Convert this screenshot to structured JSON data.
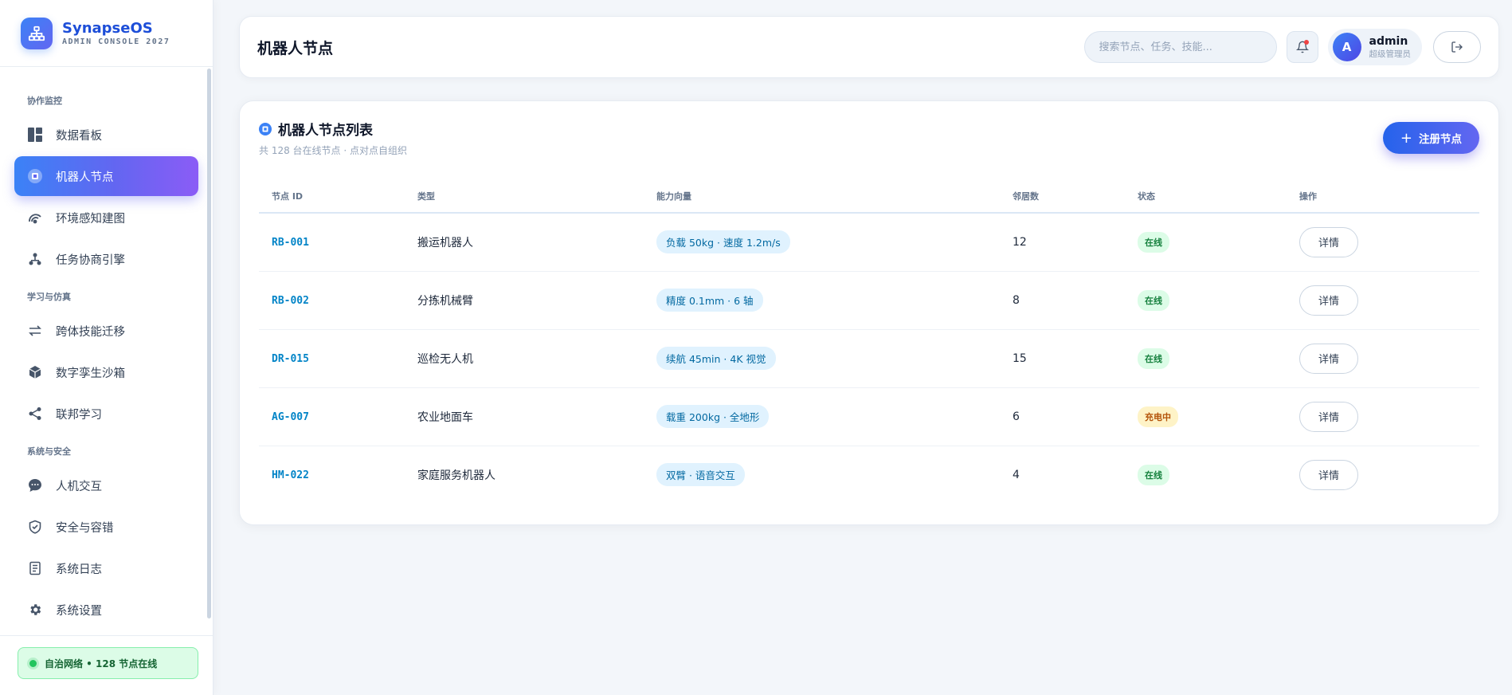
{
  "brand": {
    "name": "SynapseOS",
    "subtitle": "ADMIN CONSOLE 2027"
  },
  "sidebar": {
    "sections": [
      {
        "label": "协作监控",
        "items": [
          {
            "label": "数据看板",
            "icon": "dashboard-icon"
          },
          {
            "label": "机器人节点",
            "icon": "chip-icon",
            "active": true
          },
          {
            "label": "环境感知建图",
            "icon": "radar-icon"
          },
          {
            "label": "任务协商引擎",
            "icon": "hierarchy-icon"
          }
        ]
      },
      {
        "label": "学习与仿真",
        "items": [
          {
            "label": "跨体技能迁移",
            "icon": "swap-icon"
          },
          {
            "label": "数字孪生沙箱",
            "icon": "cube-icon"
          },
          {
            "label": "联邦学习",
            "icon": "share-icon"
          }
        ]
      },
      {
        "label": "系统与安全",
        "items": [
          {
            "label": "人机交互",
            "icon": "chat-icon"
          },
          {
            "label": "安全与容错",
            "icon": "shield-icon"
          },
          {
            "label": "系统日志",
            "icon": "log-icon"
          },
          {
            "label": "系统设置",
            "icon": "gear-icon"
          }
        ]
      }
    ],
    "footer_status": "自治网络 • 128 节点在线"
  },
  "header": {
    "title": "机器人节点",
    "search_placeholder": "搜索节点、任务、技能...",
    "user": {
      "avatar": "A",
      "name": "admin",
      "role": "超级管理员"
    }
  },
  "card": {
    "title": "机器人节点列表",
    "subtitle": "共 128 台在线节点 · 点对点自组织",
    "register_label": "注册节点",
    "columns": [
      "节点 ID",
      "类型",
      "能力向量",
      "邻居数",
      "状态",
      "操作"
    ],
    "rows": [
      {
        "id": "RB-001",
        "type": "搬运机器人",
        "capability": "负载 50kg · 速度 1.2m/s",
        "neighbors": "12",
        "status": "在线",
        "status_kind": "online",
        "action": "详情"
      },
      {
        "id": "RB-002",
        "type": "分拣机械臂",
        "capability": "精度 0.1mm · 6 轴",
        "neighbors": "8",
        "status": "在线",
        "status_kind": "online",
        "action": "详情"
      },
      {
        "id": "DR-015",
        "type": "巡检无人机",
        "capability": "续航 45min · 4K 视觉",
        "neighbors": "15",
        "status": "在线",
        "status_kind": "online",
        "action": "详情"
      },
      {
        "id": "AG-007",
        "type": "农业地面车",
        "capability": "载重 200kg · 全地形",
        "neighbors": "6",
        "status": "充电中",
        "status_kind": "charging",
        "action": "详情"
      },
      {
        "id": "HM-022",
        "type": "家庭服务机器人",
        "capability": "双臂 · 语音交互",
        "neighbors": "4",
        "status": "在线",
        "status_kind": "online",
        "action": "详情"
      }
    ]
  },
  "colors": {
    "accent": "#3b82f6",
    "accent2": "#6366f1",
    "online": "#15803d",
    "charging": "#b45309"
  }
}
